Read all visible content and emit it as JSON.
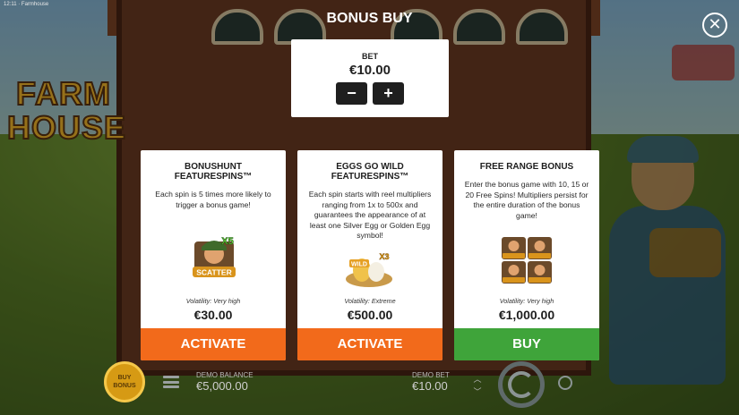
{
  "status_bar": {
    "text": "12:11 · Farmhouse"
  },
  "title": "BONUS BUY",
  "logo": {
    "line1": "FARM",
    "line2": "HOUSE"
  },
  "bet": {
    "label": "BET",
    "value": "€10.00",
    "minus": "−",
    "plus": "+"
  },
  "cards": [
    {
      "title": "BONUSHUNT FEATURESPINS™",
      "description": "Each spin is 5 times more likely to trigger a bonus game!",
      "art": "scatter-x5-icon",
      "volatility": "Volatility: Very high",
      "price": "€30.00",
      "button": "ACTIVATE",
      "button_color": "#f26a1b"
    },
    {
      "title": "EGGS GO WILD FEATURESPINS™",
      "description": "Each spin starts with reel multipliers ranging from 1x to 500x and guarantees the appearance of at least one Silver Egg or Golden Egg symbol!",
      "art": "wild-egg-nest-icon",
      "volatility": "Volatility: Extreme",
      "price": "€500.00",
      "button": "ACTIVATE",
      "button_color": "#f26a1b"
    },
    {
      "title": "FREE RANGE BONUS",
      "description": "Enter the bonus game with 10, 15 or 20 Free Spins! Multipliers persist for the entire duration of the bonus game!",
      "art": "scatter-grid-icon",
      "volatility": "Volatility: Very high",
      "price": "€1,000.00",
      "button": "BUY",
      "button_color": "#3fa43a"
    }
  ],
  "bottom_bar": {
    "buy_bonus_label": "BUY BONUS",
    "balance_label": "DEMO BALANCE",
    "balance_value": "€5,000.00",
    "bet_label": "DEMO BET",
    "bet_value": "€10.00"
  },
  "art_text": {
    "x5": "X5",
    "scatter": "SCATTER",
    "wild": "WILD",
    "x3": "X3"
  }
}
